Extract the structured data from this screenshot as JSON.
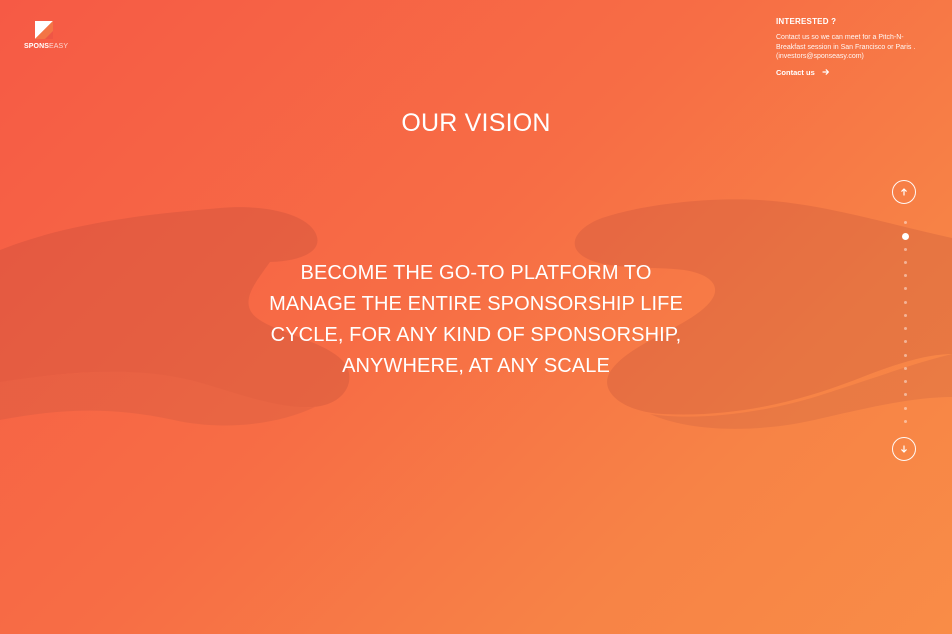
{
  "brand": {
    "name_bold": "SPONS",
    "name_light": "EASY"
  },
  "interest": {
    "title": "INTERESTED ?",
    "text": "Contact us so we can meet for a Pitch-N-Breakfast session in San Francisco or Paris . (investors@sponseasy.com)",
    "link_label": "Contact us"
  },
  "vision": {
    "title": "OUR VISION",
    "lines": [
      "BECOME THE GO-TO PLATFORM TO",
      "MANAGE THE ENTIRE SPONSORSHIP LIFE",
      "CYCLE, FOR ANY KIND OF SPONSORSHIP,",
      "ANYWHERE, AT ANY SCALE"
    ]
  },
  "navigation": {
    "up_icon": "arrow-up-icon",
    "down_icon": "arrow-down-icon",
    "dot_count": 16,
    "active_index": 1
  },
  "colors": {
    "gradient_start": "#f65a45",
    "gradient_end": "#f98c47",
    "text": "#ffffff"
  }
}
